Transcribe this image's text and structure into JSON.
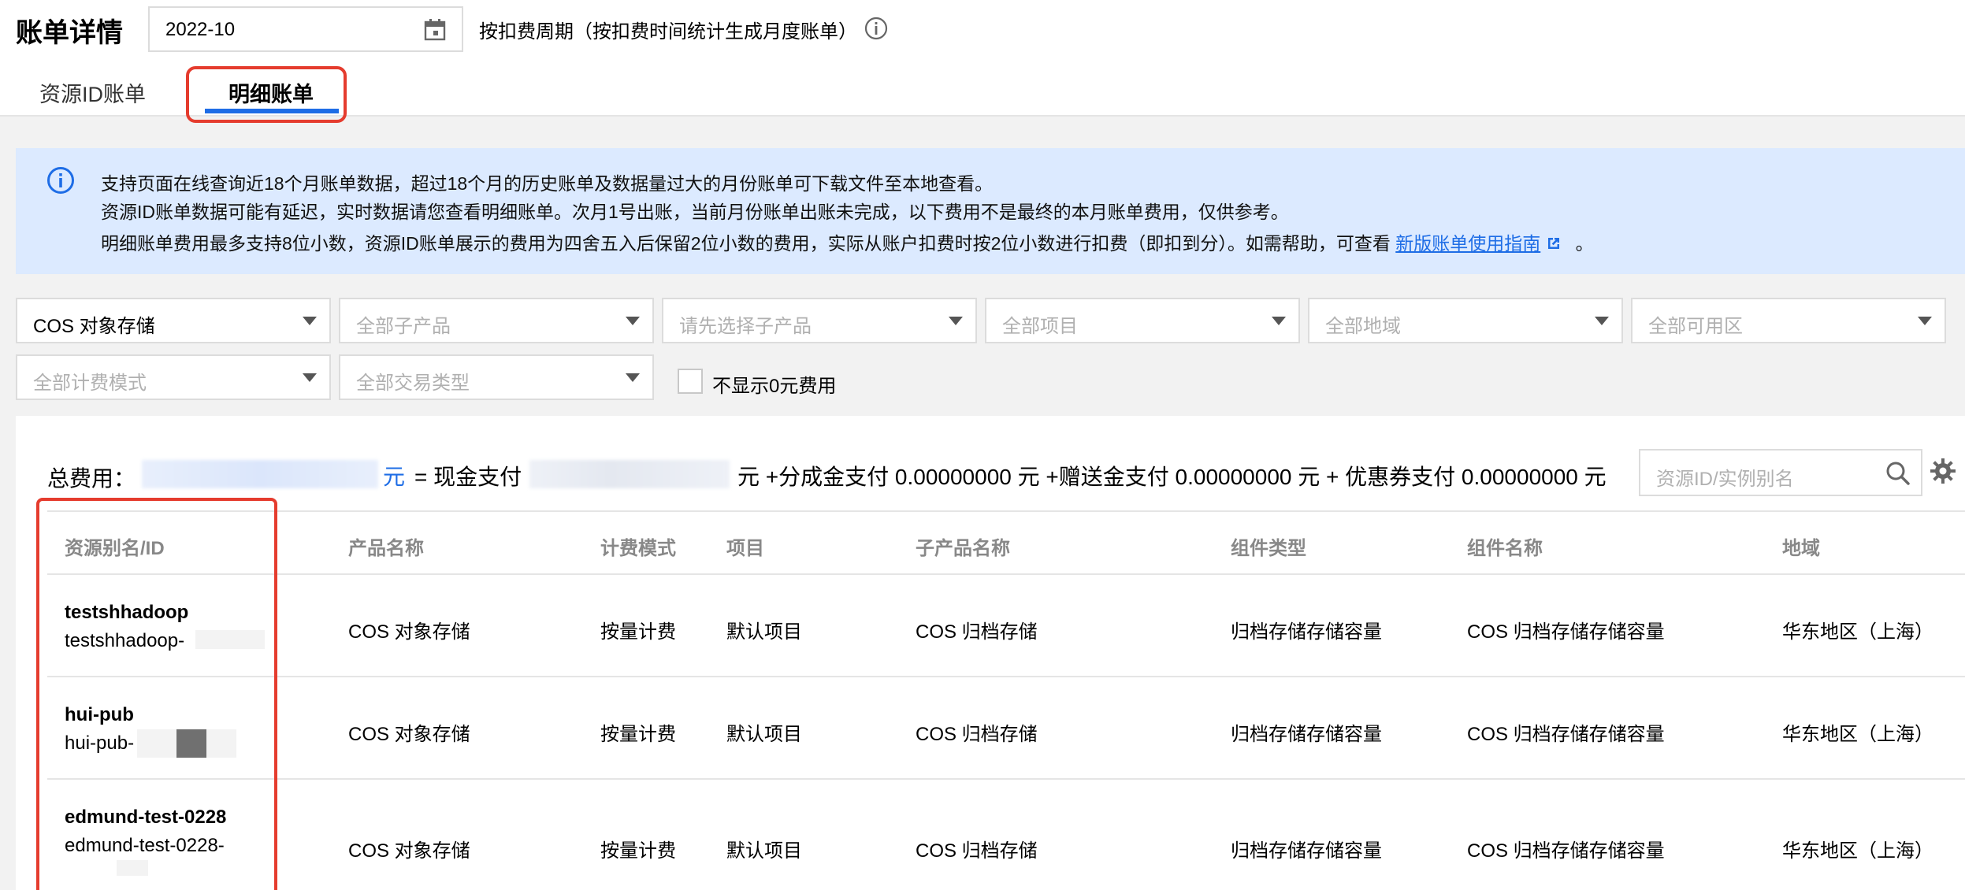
{
  "header": {
    "title": "账单详情",
    "month_value": "2022-10",
    "period_label": "按扣费周期（按扣费时间统计生成月度账单）"
  },
  "tabs": [
    {
      "label": "资源ID账单",
      "active": false
    },
    {
      "label": "明细账单",
      "active": true
    }
  ],
  "notice": {
    "lines": [
      "支持页面在线查询近18个月账单数据，超过18个月的历史账单及数据量过大的月份账单可下载文件至本地查看。",
      "资源ID账单数据可能有延迟，实时数据请您查看明细账单。次月1号出账，当前月份账单出账未完成，以下费用不是最终的本月账单费用，仅供参考。",
      "明细账单费用最多支持8位小数，资源ID账单展示的费用为四舍五入后保留2位小数的费用，实际从账户扣费时按2位小数进行扣费（即扣到分）。如需帮助，可查看"
    ],
    "link_text": "新版账单使用指南",
    "trailing": "。"
  },
  "filters": {
    "product": "COS 对象存储",
    "sub_product": "全部子产品",
    "choose_sub_product": "请先选择子产品",
    "project": "全部项目",
    "region": "全部地域",
    "zone": "全部可用区",
    "billing_mode": "全部计费模式",
    "transaction_type": "全部交易类型",
    "hide_zero_label": "不显示0元费用"
  },
  "summary": {
    "total_label": "总费用：",
    "yuan": "元",
    "eq_cash": "= 现金支付",
    "rest": "元 +分成金支付 0.00000000 元 +赠送金支付 0.00000000 元 + 优惠券支付 0.00000000 元"
  },
  "search": {
    "placeholder": "资源ID/实例别名"
  },
  "table": {
    "headers": [
      "资源别名/ID",
      "产品名称",
      "计费模式",
      "项目",
      "子产品名称",
      "组件类型",
      "组件名称",
      "地域"
    ],
    "rows": [
      {
        "name": "testshhadoop",
        "id": "testshhadoop-",
        "product": "COS 对象存储",
        "mode": "按量计费",
        "project": "默认项目",
        "sub_product": "COS 归档存储",
        "component_type": "归档存储存储容量",
        "component_name": "COS 归档存储存储容量",
        "region": "华东地区（上海）"
      },
      {
        "name": "hui-pub",
        "id": "hui-pub-",
        "product": "COS 对象存储",
        "mode": "按量计费",
        "project": "默认项目",
        "sub_product": "COS 归档存储",
        "component_type": "归档存储存储容量",
        "component_name": "COS 归档存储存储容量",
        "region": "华东地区（上海）"
      },
      {
        "name": "edmund-test-0228",
        "id": "edmund-test-0228-",
        "product": "COS 对象存储",
        "mode": "按量计费",
        "project": "默认项目",
        "sub_product": "COS 归档存储",
        "component_type": "归档存储存储容量",
        "component_name": "COS 归档存储存储容量",
        "region": "华东地区（上海）"
      }
    ]
  },
  "colors": {
    "accent": "#1e6de6",
    "highlight": "#e53c2e",
    "notice_bg": "#dceaff"
  }
}
